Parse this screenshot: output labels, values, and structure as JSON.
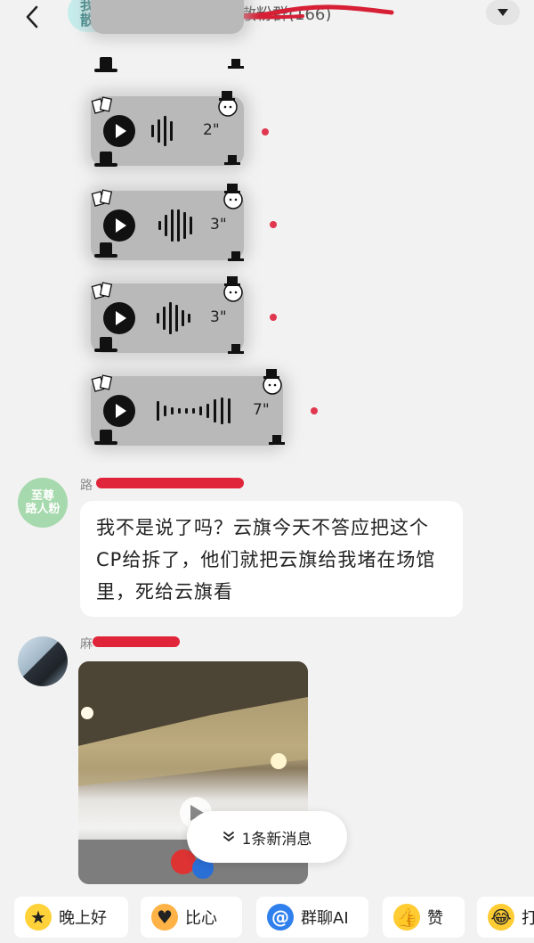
{
  "header": {
    "group_badge_line1": "我是",
    "group_badge_line2": "散粉",
    "group_title": "《云烟是河魔爱散粉群",
    "member_count": "(166)"
  },
  "voice_messages": [
    {
      "duration": "2\""
    },
    {
      "duration": "3\""
    },
    {
      "duration": "3\""
    },
    {
      "duration": "7\""
    }
  ],
  "text_message": {
    "avatar_line1": "至尊",
    "avatar_line2": "路人粉",
    "sender_prefix": "路",
    "text": "我不是说了吗？云旗今天不答应把这个CP给拆了，他们就把云旗给我堵在场馆里，死给云旗看"
  },
  "photo_message": {
    "sender_prefix": "麻"
  },
  "new_message_pill": {
    "label": "1条新消息"
  },
  "quick_actions": [
    {
      "label": "晚上好",
      "icon": "star-face-icon"
    },
    {
      "label": "比心",
      "icon": "heart-hands-icon"
    },
    {
      "label": "群聊AI",
      "icon": "at-icon"
    },
    {
      "label": "赞",
      "icon": "thumbs-up-icon"
    },
    {
      "label": "打",
      "icon": "laugh-cry-icon"
    }
  ],
  "colors": {
    "background": "#f2f2f2",
    "unread_dot": "#e0374f",
    "redaction": "#e0243a",
    "badge_bg": "#c7ecec",
    "avatar_green": "#a6d9ad"
  }
}
